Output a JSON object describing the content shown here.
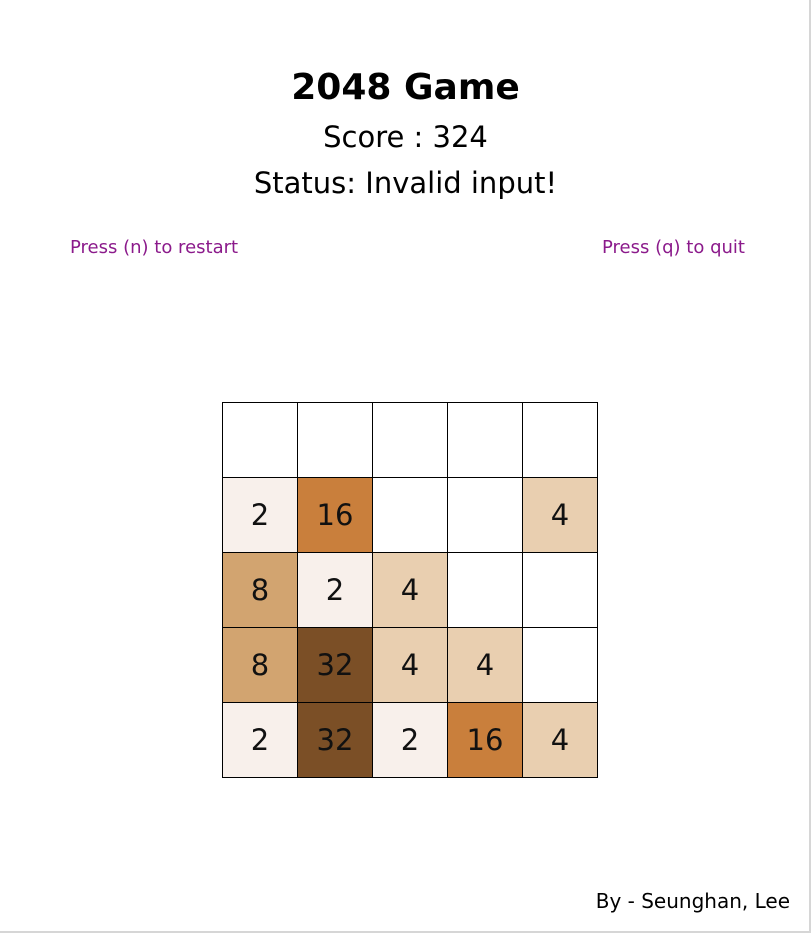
{
  "title": "2048 Game",
  "score_text": "Score : 324",
  "status_text": "Status: Invalid input!",
  "controls": {
    "restart_hint": "Press (n) to restart",
    "quit_hint": "Press (q) to quit"
  },
  "board": {
    "rows": [
      [
        "",
        "",
        "",
        "",
        ""
      ],
      [
        "2",
        "16",
        "",
        "",
        "4"
      ],
      [
        "8",
        "2",
        "4",
        "",
        ""
      ],
      [
        "8",
        "32",
        "4",
        "4",
        ""
      ],
      [
        "2",
        "32",
        "2",
        "16",
        "4"
      ]
    ]
  },
  "tile_colors": {
    "empty": "#ffffff",
    "2": "#f8f0eb",
    "4": "#e9cfb0",
    "8": "#d2a470",
    "16": "#c97f3c",
    "32": "#7b4f26"
  },
  "hint_color": "#8b1a8b",
  "credit": "By - Seunghan, Lee"
}
